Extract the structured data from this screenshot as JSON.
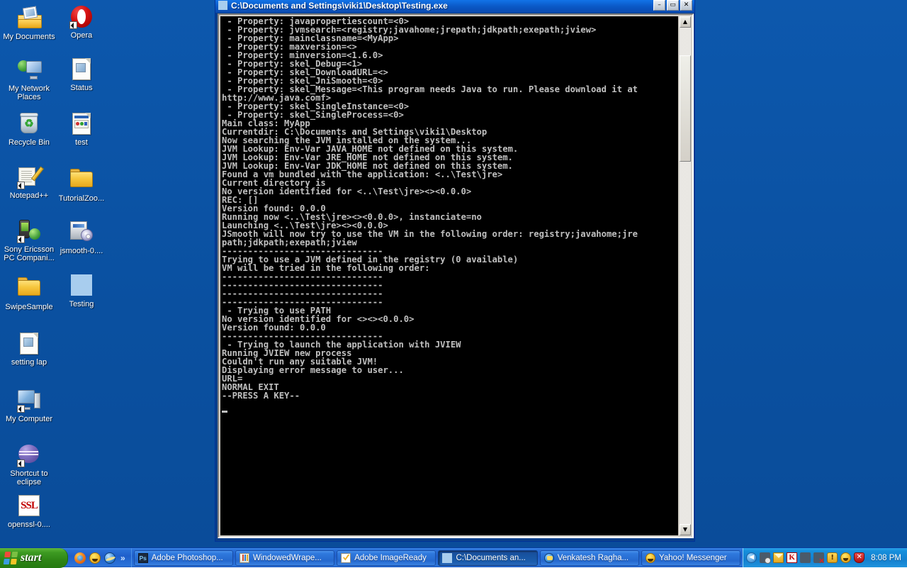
{
  "desktop": {
    "background_color": "#0a54a8",
    "icons": [
      {
        "label": "My Documents",
        "icon": "my-documents-icon",
        "shortcut": false
      },
      {
        "label": "Opera",
        "icon": "opera-icon",
        "shortcut": true
      },
      {
        "label": "My Network Places",
        "icon": "network-places-icon",
        "shortcut": false
      },
      {
        "label": "Status",
        "icon": "document-icon",
        "shortcut": false
      },
      {
        "label": "Recycle Bin",
        "icon": "recycle-bin-icon",
        "shortcut": false
      },
      {
        "label": "test",
        "icon": "html-document-icon",
        "shortcut": false
      },
      {
        "label": "Notepad++",
        "icon": "notepad-plus-plus-icon",
        "shortcut": true
      },
      {
        "label": "TutorialZoo...",
        "icon": "folder-icon",
        "shortcut": false
      },
      {
        "label": "Sony Ericsson PC Compani...",
        "icon": "sony-ericsson-icon",
        "shortcut": true
      },
      {
        "label": "jsmooth-0....",
        "icon": "installer-cd-icon",
        "shortcut": false
      },
      {
        "label": "SwipeSample",
        "icon": "folder-icon",
        "shortcut": false
      },
      {
        "label": "Testing",
        "icon": "blue-square-icon",
        "shortcut": false
      },
      {
        "label": "setting lap",
        "icon": "document-icon",
        "shortcut": false
      },
      {
        "label": "My Computer",
        "icon": "my-computer-icon",
        "shortcut": true
      },
      {
        "label": "Shortcut to eclipse",
        "icon": "eclipse-icon",
        "shortcut": true
      },
      {
        "label": "openssl-0....",
        "icon": "ssl-icon",
        "shortcut": false
      }
    ]
  },
  "console_window": {
    "title": "C:\\Documents and Settings\\viki1\\Desktop\\Testing.exe",
    "title_icon": "console-window-icon",
    "buttons": {
      "minimize": "–",
      "maximize": "▭",
      "close": "✕"
    },
    "scrollbar": {
      "up_arrow": "▲",
      "down_arrow": "▼"
    },
    "output": " - Property: javapropertiescount=<0>\n - Property: jvmsearch=<registry;javahome;jrepath;jdkpath;exepath;jview>\n - Property: mainclassname=<MyApp>\n - Property: maxversion=<>\n - Property: minversion=<1.6.0>\n - Property: skel_Debug=<1>\n - Property: skel_DownloadURL=<>\n - Property: skel_JniSmooth=<0>\n - Property: skel_Message=<This program needs Java to run. Please download it at\nhttp://www.java.comf>\n - Property: skel_SingleInstance=<0>\n - Property: skel_SingleProcess=<0>\nMain class: MyApp\nCurrentdir: C:\\Documents and Settings\\viki1\\Desktop\nNow searching the JVM installed on the system...\nJVM Lookup: Env-Var JAVA_HOME not defined on this system.\nJVM Lookup: Env-Var JRE_HOME not defined on this system.\nJVM Lookup: Env-Var JDK_HOME not defined on this system.\nFound a vm bundled with the application: <..\\Test\\jre>\nCurrent directory is\nNo version identified for <..\\Test\\jre><><0.0.0>\nREC: []\nVersion found: 0.0.0\nRunning now <..\\Test\\jre><><0.0.0>, instanciate=no\nLaunching <..\\Test\\jre><><0.0.0>\nJSmooth will now try to use the VM in the following order: registry;javahome;jre\npath;jdkpath;exepath;jview\n-------------------------------\nTrying to use a JVM defined in the registry (0 available)\nVM will be tried in the following order:\n-------------------------------\n-------------------------------\n-------------------------------\n-------------------------------\n - Trying to use PATH\nNo version identified for <><><0.0.0>\nVersion found: 0.0.0\n-------------------------------\n - Trying to launch the application with JVIEW\nRunning JVIEW new process\nCouldn't run any suitable JVM!\nDisplaying error message to user...\nURL=\nNORMAL EXIT\n--PRESS A KEY--"
  },
  "taskbar": {
    "start_label": "start",
    "quick_launch": [
      {
        "name": "firefox-icon"
      },
      {
        "name": "yahoo-messenger-icon"
      },
      {
        "name": "internet-explorer-icon"
      }
    ],
    "quick_launch_more": "»",
    "tasks": [
      {
        "label": "Adobe Photoshop...",
        "icon": "photoshop-icon",
        "active": false
      },
      {
        "label": "WindowedWrape...",
        "icon": "windowed-wrapper-icon",
        "active": false
      },
      {
        "label": "Adobe ImageReady",
        "icon": "imageready-icon",
        "active": false
      },
      {
        "label": "C:\\Documents an...",
        "icon": "console-window-icon",
        "active": true
      },
      {
        "label": "Venkatesh Ragha...",
        "icon": "messenger-chat-icon",
        "active": false
      },
      {
        "label": "Yahoo! Messenger",
        "icon": "yahoo-messenger-icon",
        "active": false
      }
    ],
    "tray": {
      "chevron": "◀",
      "icons": [
        {
          "name": "network-disconnected-icon"
        },
        {
          "name": "mail-icon"
        },
        {
          "name": "kaspersky-icon",
          "glyph": "K"
        },
        {
          "name": "wireless-network-icon"
        },
        {
          "name": "local-area-connection-icon"
        },
        {
          "name": "warning-icon",
          "glyph": "!"
        },
        {
          "name": "yahoo-messenger-tray-icon"
        },
        {
          "name": "security-center-icon",
          "glyph": "✕"
        }
      ],
      "clock": "8:08 PM"
    }
  }
}
